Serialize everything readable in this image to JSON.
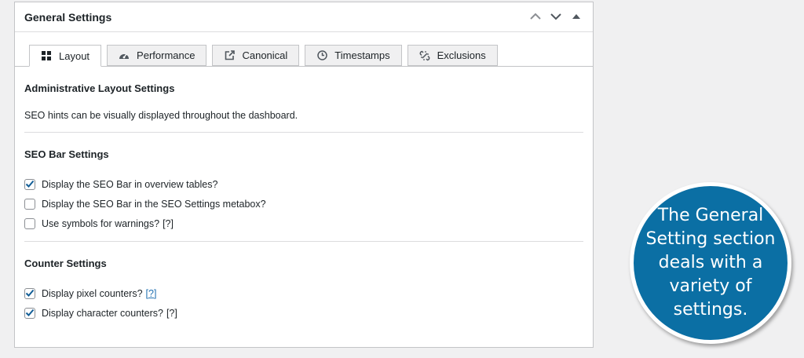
{
  "panel": {
    "title": "General Settings"
  },
  "tabs": [
    {
      "label": "Layout",
      "icon": "grid-icon",
      "active": true
    },
    {
      "label": "Performance",
      "icon": "dashboard-icon",
      "active": false
    },
    {
      "label": "Canonical",
      "icon": "external-link-icon",
      "active": false
    },
    {
      "label": "Timestamps",
      "icon": "clock-icon",
      "active": false
    },
    {
      "label": "Exclusions",
      "icon": "broken-link-icon",
      "active": false
    }
  ],
  "admin_layout": {
    "title": "Administrative Layout Settings",
    "description": "SEO hints can be visually displayed throughout the dashboard."
  },
  "seo_bar": {
    "title": "SEO Bar Settings",
    "options": [
      {
        "label": "Display the SEO Bar in overview tables?",
        "checked": true
      },
      {
        "label": "Display the SEO Bar in the SEO Settings metabox?",
        "checked": false
      },
      {
        "label": "Use symbols for warnings?",
        "checked": false,
        "help": "[?]"
      }
    ]
  },
  "counter": {
    "title": "Counter Settings",
    "options": [
      {
        "label": "Display pixel counters?",
        "checked": true,
        "help": "[?]"
      },
      {
        "label": "Display character counters?",
        "checked": true,
        "help": "[?]"
      }
    ]
  },
  "callout": {
    "text": "The General Setting section deals with a variety of settings."
  },
  "colors": {
    "accent": "#2271b1",
    "bubble": "#0b6fa4",
    "check": "#135e96"
  }
}
